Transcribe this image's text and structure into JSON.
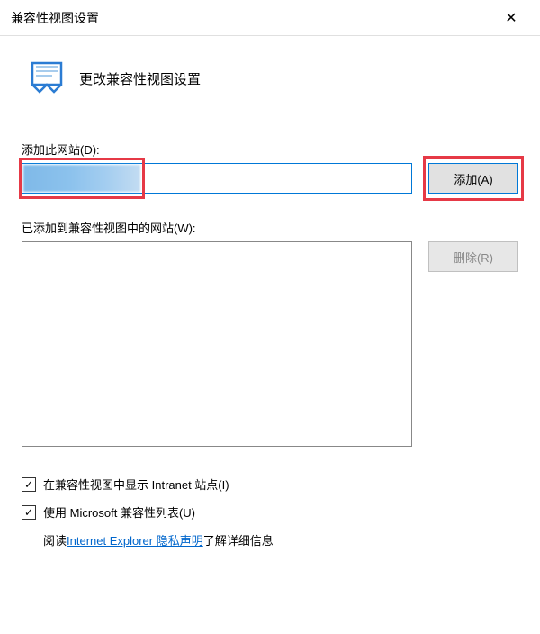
{
  "titlebar": {
    "title": "兼容性视图设置"
  },
  "header": {
    "text": "更改兼容性视图设置"
  },
  "add_section": {
    "label": "添加此网站(D):",
    "input_value": "",
    "add_button": "添加(A)"
  },
  "list_section": {
    "label": "已添加到兼容性视图中的网站(W):",
    "remove_button": "删除(R)"
  },
  "checkboxes": {
    "intranet": "在兼容性视图中显示 Intranet 站点(I)",
    "microsoft_list": "使用 Microsoft 兼容性列表(U)"
  },
  "privacy": {
    "prefix": "阅读 ",
    "link": "Internet Explorer 隐私声明",
    "suffix": "了解详细信息"
  },
  "icons": {
    "close": "✕",
    "check": "✓"
  }
}
